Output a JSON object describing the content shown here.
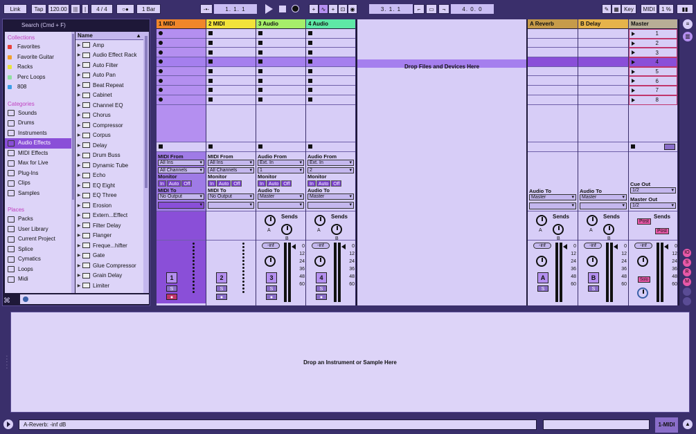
{
  "transport": {
    "link": "Link",
    "tap": "Tap",
    "tempo": "120.00",
    "signature": "4 / 4",
    "quantization": "1 Bar",
    "arrangement_position": "1.  1.  1",
    "loop_start": "3.  1.  1",
    "loop_length": "4.  0.  0",
    "key": "Key",
    "midi": "MIDI",
    "cpu": "1 %"
  },
  "browser": {
    "search_placeholder": "Search (Cmd + F)",
    "name_header": "Name",
    "collections_title": "Collections",
    "collections": [
      {
        "label": "Favorites",
        "color": "#e8413a"
      },
      {
        "label": "Favorite Guitar",
        "color": "#f0a02c"
      },
      {
        "label": "Racks",
        "color": "#e9e33a"
      },
      {
        "label": "Perc Loops",
        "color": "#8fe0a0"
      },
      {
        "label": "808",
        "color": "#3a9ee8"
      }
    ],
    "categories_title": "Categories",
    "categories": [
      {
        "label": "Sounds",
        "icon": "note-icon"
      },
      {
        "label": "Drums",
        "icon": "drums-icon"
      },
      {
        "label": "Instruments",
        "icon": "instrument-icon"
      },
      {
        "label": "Audio Effects",
        "icon": "audio-effect-icon",
        "selected": true
      },
      {
        "label": "MIDI Effects",
        "icon": "midi-effect-icon"
      },
      {
        "label": "Max for Live",
        "icon": "max-icon"
      },
      {
        "label": "Plug-Ins",
        "icon": "plugin-icon"
      },
      {
        "label": "Clips",
        "icon": "clip-icon"
      },
      {
        "label": "Samples",
        "icon": "sample-icon"
      }
    ],
    "places_title": "Places",
    "places": [
      "Packs",
      "User Library",
      "Current Project",
      "Splice",
      "Cymatics",
      "Loops",
      "Midi"
    ],
    "items": [
      "Amp",
      "Audio Effect Rack",
      "Auto Filter",
      "Auto Pan",
      "Beat Repeat",
      "Cabinet",
      "Channel EQ",
      "Chorus",
      "Compressor",
      "Corpus",
      "Delay",
      "Drum Buss",
      "Dynamic Tube",
      "Echo",
      "EQ Eight",
      "EQ Three",
      "Erosion",
      "Extern...Effect",
      "Filter Delay",
      "Flanger",
      "Freque...hifter",
      "Gate",
      "Glue Compressor",
      "Grain Delay",
      "Limiter"
    ]
  },
  "tracks": [
    {
      "name": "1 MIDI",
      "color": "#f0862a",
      "type": "midi",
      "number": "1",
      "from_label": "MIDI From",
      "from": "All Ins",
      "channel": "All Channels",
      "to_label": "MIDI To",
      "to": "No Output"
    },
    {
      "name": "2 MIDI",
      "color": "#f2e23a",
      "type": "midi",
      "number": "2",
      "from_label": "MIDI From",
      "from": "All Ins",
      "channel": "All Channels",
      "to_label": "MIDI To",
      "to": "No Output"
    },
    {
      "name": "3 Audio",
      "color": "#a6ee6a",
      "type": "audio",
      "number": "3",
      "from_label": "Audio From",
      "from": "Ext. In",
      "channel": "1",
      "to_label": "Audio To",
      "to": "Master"
    },
    {
      "name": "4 Audio",
      "color": "#5ee8a6",
      "type": "audio",
      "number": "4",
      "from_label": "Audio From",
      "from": "Ext. In",
      "channel": "2",
      "to_label": "Audio To",
      "to": "Master"
    }
  ],
  "returns": [
    {
      "name": "A Reverb",
      "color": "#c69b4a",
      "letter": "A",
      "to_label": "Audio To",
      "to": "Master"
    },
    {
      "name": "B Delay",
      "color": "#e6b34a",
      "letter": "B",
      "to_label": "Audio To",
      "to": "Master"
    }
  ],
  "master": {
    "name": "Master",
    "color": "#b8ae96",
    "scenes": [
      "1",
      "2",
      "3",
      "4",
      "5",
      "6",
      "7",
      "8"
    ],
    "cue_out_label": "Cue Out",
    "cue_out": "1/2",
    "master_out_label": "Master Out",
    "master_out": "1/2",
    "post": "Post",
    "solo": "Solo"
  },
  "mixer": {
    "monitor_label": "Monitor",
    "monitor_in": "In",
    "monitor_auto": "Auto",
    "monitor_off": "Off",
    "sends_label": "Sends",
    "send_a": "A",
    "send_b": "B",
    "vol": "-inf",
    "solo": "S",
    "scale": [
      "0",
      "12",
      "24",
      "36",
      "48",
      "60"
    ]
  },
  "drop_files_text": "Drop Files and Devices Here",
  "drop_instrument_text": "Drop an Instrument or Sample Here",
  "status_text": "A-Reverb: -inf dB",
  "status_track": "1-MIDI"
}
